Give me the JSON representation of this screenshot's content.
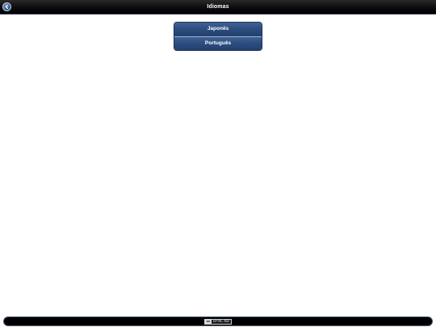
{
  "header": {
    "title": "Idiomas",
    "back_icon": "back-arrow-icon"
  },
  "languages": [
    {
      "label": "Japonês"
    },
    {
      "label": "Português"
    }
  ],
  "footer": {
    "license_icon_text": "cc",
    "license_text": "BY-NC-ND"
  },
  "colors": {
    "nav_bar": "#000000",
    "list_item": "#2c4c7e",
    "accent_back": "#3a5f92"
  }
}
